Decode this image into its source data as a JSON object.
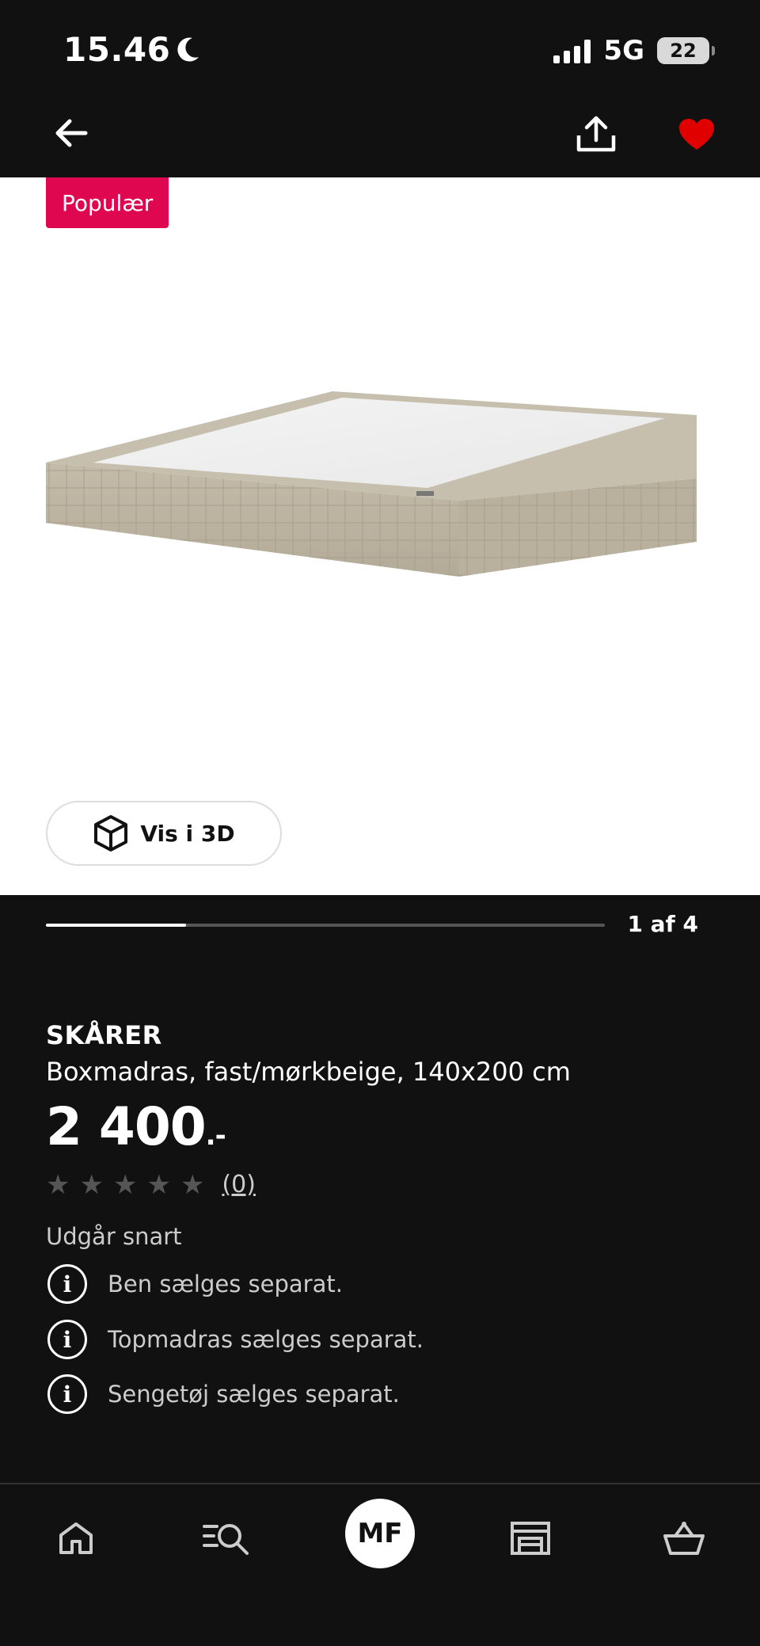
{
  "status_bar": {
    "time": "15.46",
    "network": "5G",
    "battery": "22"
  },
  "nav": {
    "back_icon": "arrow-left-icon",
    "share_icon": "share-icon",
    "favorite_icon": "heart-icon",
    "favorite_color": "#e00000"
  },
  "product_image": {
    "badge": "Populær",
    "badge_color": "#e00751",
    "view_3d_label": "Vis i 3D",
    "counter": "1 af 4",
    "progress_fraction": 0.25
  },
  "product": {
    "name": "SKÅRER",
    "description": "Boxmadras, fast/mørkbeige, 140x200 cm",
    "price": "2 400",
    "price_suffix": ".-",
    "rating_stars": 5,
    "rating_count": "(0)",
    "availability": "Udgår snart",
    "notes": [
      "Ben sælges separat.",
      "Topmadras sælges separat.",
      "Sengetøj sælges separat."
    ]
  },
  "tab_bar": {
    "home_icon": "home-icon",
    "search_icon": "search-icon",
    "avatar_initials": "MF",
    "store_icon": "store-icon",
    "basket_icon": "basket-icon"
  }
}
